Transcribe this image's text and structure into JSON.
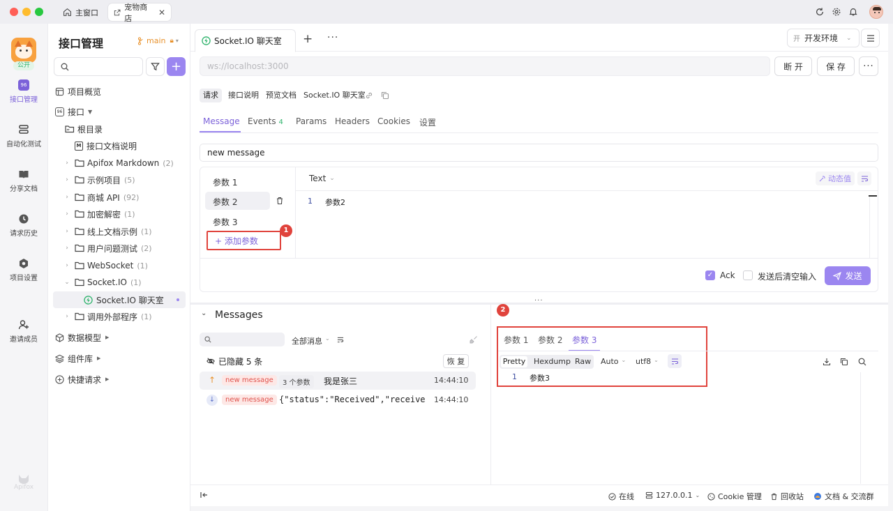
{
  "window": {
    "tabs": [
      {
        "label": "主窗口",
        "icon": "home-icon"
      },
      {
        "label": "宠物商店",
        "icon": "external-link-icon"
      }
    ]
  },
  "rail": {
    "badge": "公开",
    "items": [
      {
        "label": "接口管理",
        "icon": "api-icon"
      },
      {
        "label": "自动化测试",
        "icon": "layers-icon"
      },
      {
        "label": "分享文档",
        "icon": "book-icon"
      },
      {
        "label": "请求历史",
        "icon": "history-icon"
      },
      {
        "label": "项目设置",
        "icon": "settings-hex-icon"
      },
      {
        "label": "邀请成员",
        "icon": "add-user-icon"
      }
    ],
    "footer_logo": "Apifox"
  },
  "tree": {
    "title": "接口管理",
    "branch": "main",
    "items": [
      {
        "label": "项目概览",
        "count": ""
      },
      {
        "label": "接口",
        "count": ""
      },
      {
        "label": "根目录",
        "count": ""
      },
      {
        "label": "接口文档说明",
        "count": ""
      },
      {
        "label": "Apifox Markdown",
        "count": "(2)"
      },
      {
        "label": "示例项目",
        "count": "(5)"
      },
      {
        "label": "商城 API",
        "count": "(92)"
      },
      {
        "label": "加密解密",
        "count": "(1)"
      },
      {
        "label": "线上文档示例",
        "count": "(1)"
      },
      {
        "label": "用户问题测试",
        "count": "(2)"
      },
      {
        "label": "WebSocket",
        "count": "(1)"
      },
      {
        "label": "Socket.IO",
        "count": "(1)"
      },
      {
        "label": "Socket.IO 聊天室",
        "count": ""
      },
      {
        "label": "调用外部程序",
        "count": "(1)"
      },
      {
        "label": "数据模型",
        "count": ""
      },
      {
        "label": "组件库",
        "count": ""
      },
      {
        "label": "快捷请求",
        "count": ""
      }
    ]
  },
  "main": {
    "tab_label": "Socket.IO 聊天室",
    "env_prefix": "开",
    "env_label": "开发环境",
    "url_placeholder": "ws://localhost:3000",
    "disconnect_label": "断 开",
    "save_label": "保 存",
    "mode_tabs": [
      "请求",
      "接口说明",
      "预览文档"
    ],
    "endpoint_name": "Socket.IO 聊天室",
    "subtabs": [
      "Message",
      "Events",
      "Params",
      "Headers",
      "Cookies",
      "设置"
    ],
    "events_count": "4",
    "event_name": "new message",
    "params": [
      "参数 1",
      "参数 2",
      "参数 3"
    ],
    "add_param_label": "+ 添加参数",
    "body_type": "Text",
    "dynamic_value_label": "动态值",
    "editor_line": "1",
    "editor_text": "参数2",
    "ack_label": "Ack",
    "clear_after_send_label": "发送后清空输入",
    "send_label": "发送",
    "annotation_1": "1",
    "annotation_2": "2"
  },
  "messages": {
    "title": "Messages",
    "filter_label": "全部消息",
    "hidden_label": "已隐藏 5 条",
    "restore_label": "恢 复",
    "rows": [
      {
        "direction": "up",
        "event": "new message",
        "params": "3 个参数",
        "content": "我是张三",
        "time": "14:44:10"
      },
      {
        "direction": "down",
        "event": "new message",
        "params": "",
        "content": "{\"status\":\"Received\",\"receive…",
        "time": "14:44:10"
      }
    ],
    "detail_tabs": [
      "参数 1",
      "参数 2",
      "参数 3"
    ],
    "format_tabs": [
      "Pretty",
      "Hexdump",
      "Raw"
    ],
    "auto_label": "Auto",
    "encoding_label": "utf8",
    "detail_line": "1",
    "detail_text": "参数3"
  },
  "statusbar": {
    "online": "在线",
    "host": "127.0.0.1",
    "cookie": "Cookie 管理",
    "trash": "回收站",
    "docs": "文档 & 交流群"
  },
  "colors": {
    "accent": "#9b86f0",
    "accent_text": "#7b61d9",
    "annotation_red": "#e0433c",
    "success_green": "#2fb36c",
    "branch_orange": "#e8912b"
  }
}
